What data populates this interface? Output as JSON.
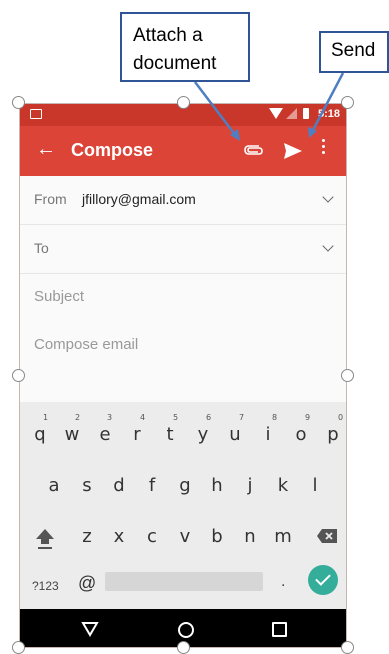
{
  "status_bar": {
    "time": "5:18"
  },
  "toolbar": {
    "back_icon": "arrow-back-icon",
    "title": "Compose",
    "attach_icon": "paperclip-icon",
    "send_icon": "send-icon",
    "more_icon": "more-vert-icon"
  },
  "fields": {
    "from_label": "From",
    "from_value": "jfillory@gmail.com",
    "to_label": "To",
    "subject_placeholder": "Subject",
    "body_placeholder": "Compose email"
  },
  "keyboard": {
    "row1": [
      "q",
      "w",
      "e",
      "r",
      "t",
      "y",
      "u",
      "i",
      "o",
      "p"
    ],
    "row1_hints": [
      "1",
      "2",
      "3",
      "4",
      "5",
      "6",
      "7",
      "8",
      "9",
      "0"
    ],
    "row2": [
      "a",
      "s",
      "d",
      "f",
      "g",
      "h",
      "j",
      "k",
      "l"
    ],
    "row3": [
      "z",
      "x",
      "c",
      "v",
      "b",
      "n",
      "m"
    ],
    "symbols_label": "?123",
    "at_label": "@",
    "dot_label": "."
  },
  "annotations": {
    "attach_callout": "Attach a document",
    "send_callout": "Send"
  },
  "colors": {
    "toolbar": "#db4437",
    "status_bar": "#c9362a",
    "enter_key": "#34ad9a",
    "callout_border": "#2f5597",
    "arrow": "#4f7fc3"
  }
}
